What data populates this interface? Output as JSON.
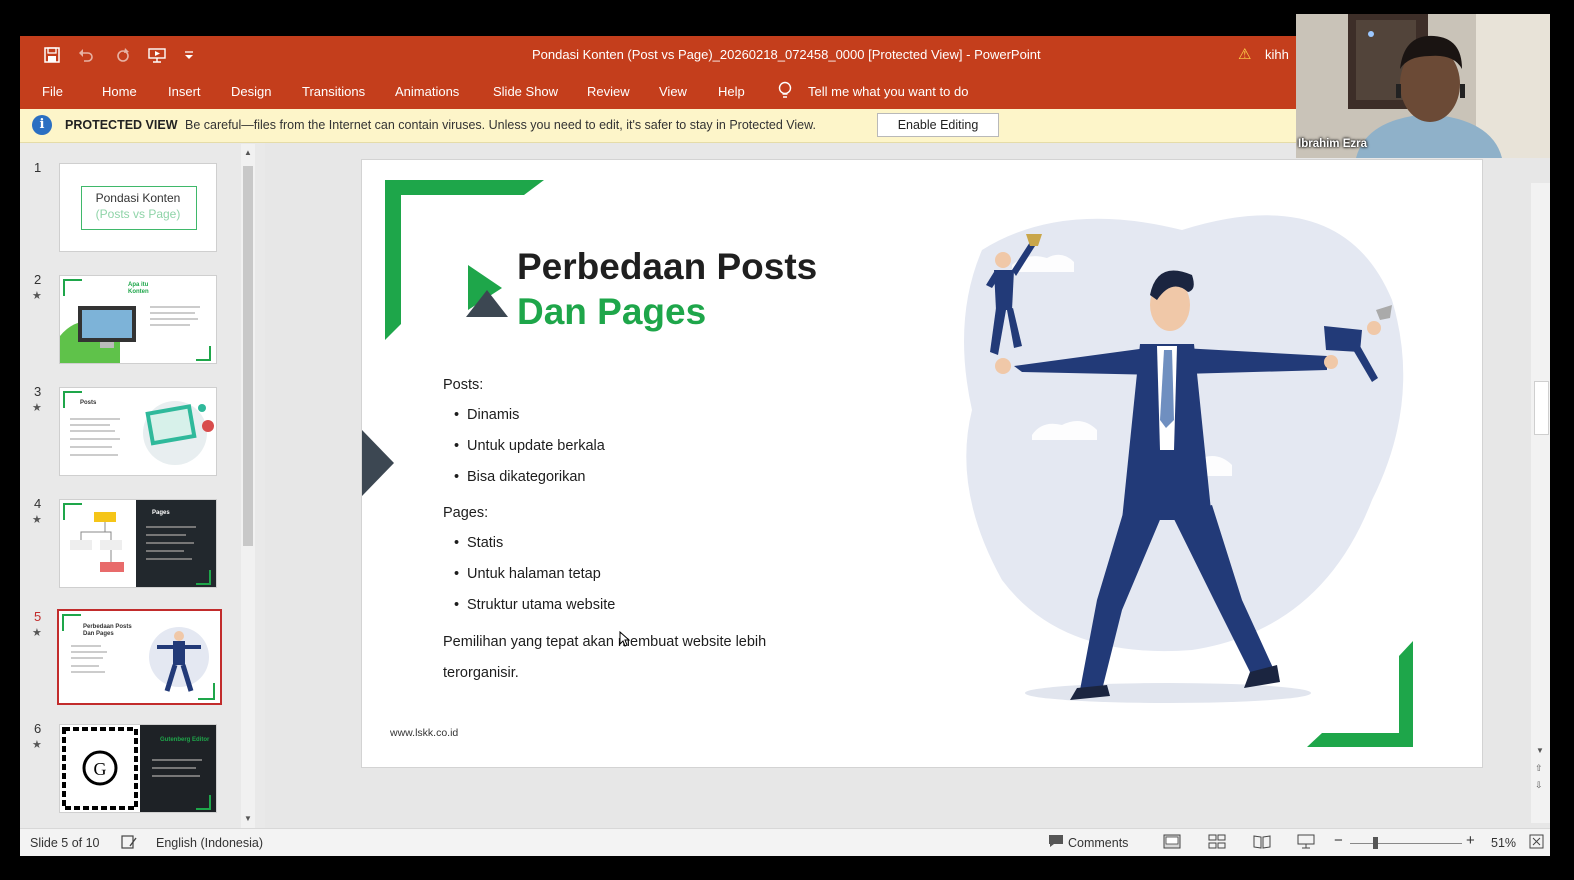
{
  "window": {
    "title": "Pondasi Konten (Post vs Page)_20260218_072458_0000 [Protected View]  -  PowerPoint",
    "user": "kihh",
    "quick_access": [
      "save-icon",
      "undo-icon",
      "redo-icon",
      "start-from-beginning-icon",
      "customize-qat-icon"
    ]
  },
  "ribbon": {
    "tabs": [
      "File",
      "Home",
      "Insert",
      "Design",
      "Transitions",
      "Animations",
      "Slide Show",
      "Review",
      "View",
      "Help"
    ],
    "tell_me": "Tell me what you want to do"
  },
  "protected_view": {
    "label": "PROTECTED VIEW",
    "message": "Be careful—files from the Internet can contain viruses. Unless you need to edit, it's safer to stay in Protected View.",
    "button": "Enable Editing"
  },
  "thumbnails": [
    {
      "number": "1",
      "star": "",
      "title_line1": "Pondasi Konten",
      "title_line2": "(Posts vs Page)"
    },
    {
      "number": "2",
      "star": "★",
      "label": "Apa itu Konten"
    },
    {
      "number": "3",
      "star": "★",
      "label": "Posts"
    },
    {
      "number": "4",
      "star": "★",
      "label": "Pages"
    },
    {
      "number": "5",
      "star": "★",
      "label": "Perbedaan Posts Dan Pages",
      "active": true
    },
    {
      "number": "6",
      "star": "★",
      "label": "Gutenberg Editor"
    }
  ],
  "slide": {
    "title_line1": "Perbedaan Posts",
    "title_line2": "Dan Pages",
    "posts_heading": "Posts:",
    "posts_items": [
      "Dinamis",
      "Untuk update berkala",
      "Bisa dikategorikan"
    ],
    "pages_heading": "Pages:",
    "pages_items": [
      "Statis",
      "Untuk halaman tetap",
      "Struktur utama website"
    ],
    "conclusion_line1": "Pemilihan yang tepat akan membuat website lebih",
    "conclusion_line2": "terorganisir.",
    "url": "www.lskk.co.id",
    "accent_color": "#1ea64a",
    "dark_color": "#3c4752"
  },
  "status": {
    "slide_info": "Slide 5 of 10",
    "language": "English (Indonesia)",
    "comments": "Comments",
    "zoom": "51%"
  },
  "webcam": {
    "name": "Ibrahim Ezra"
  }
}
